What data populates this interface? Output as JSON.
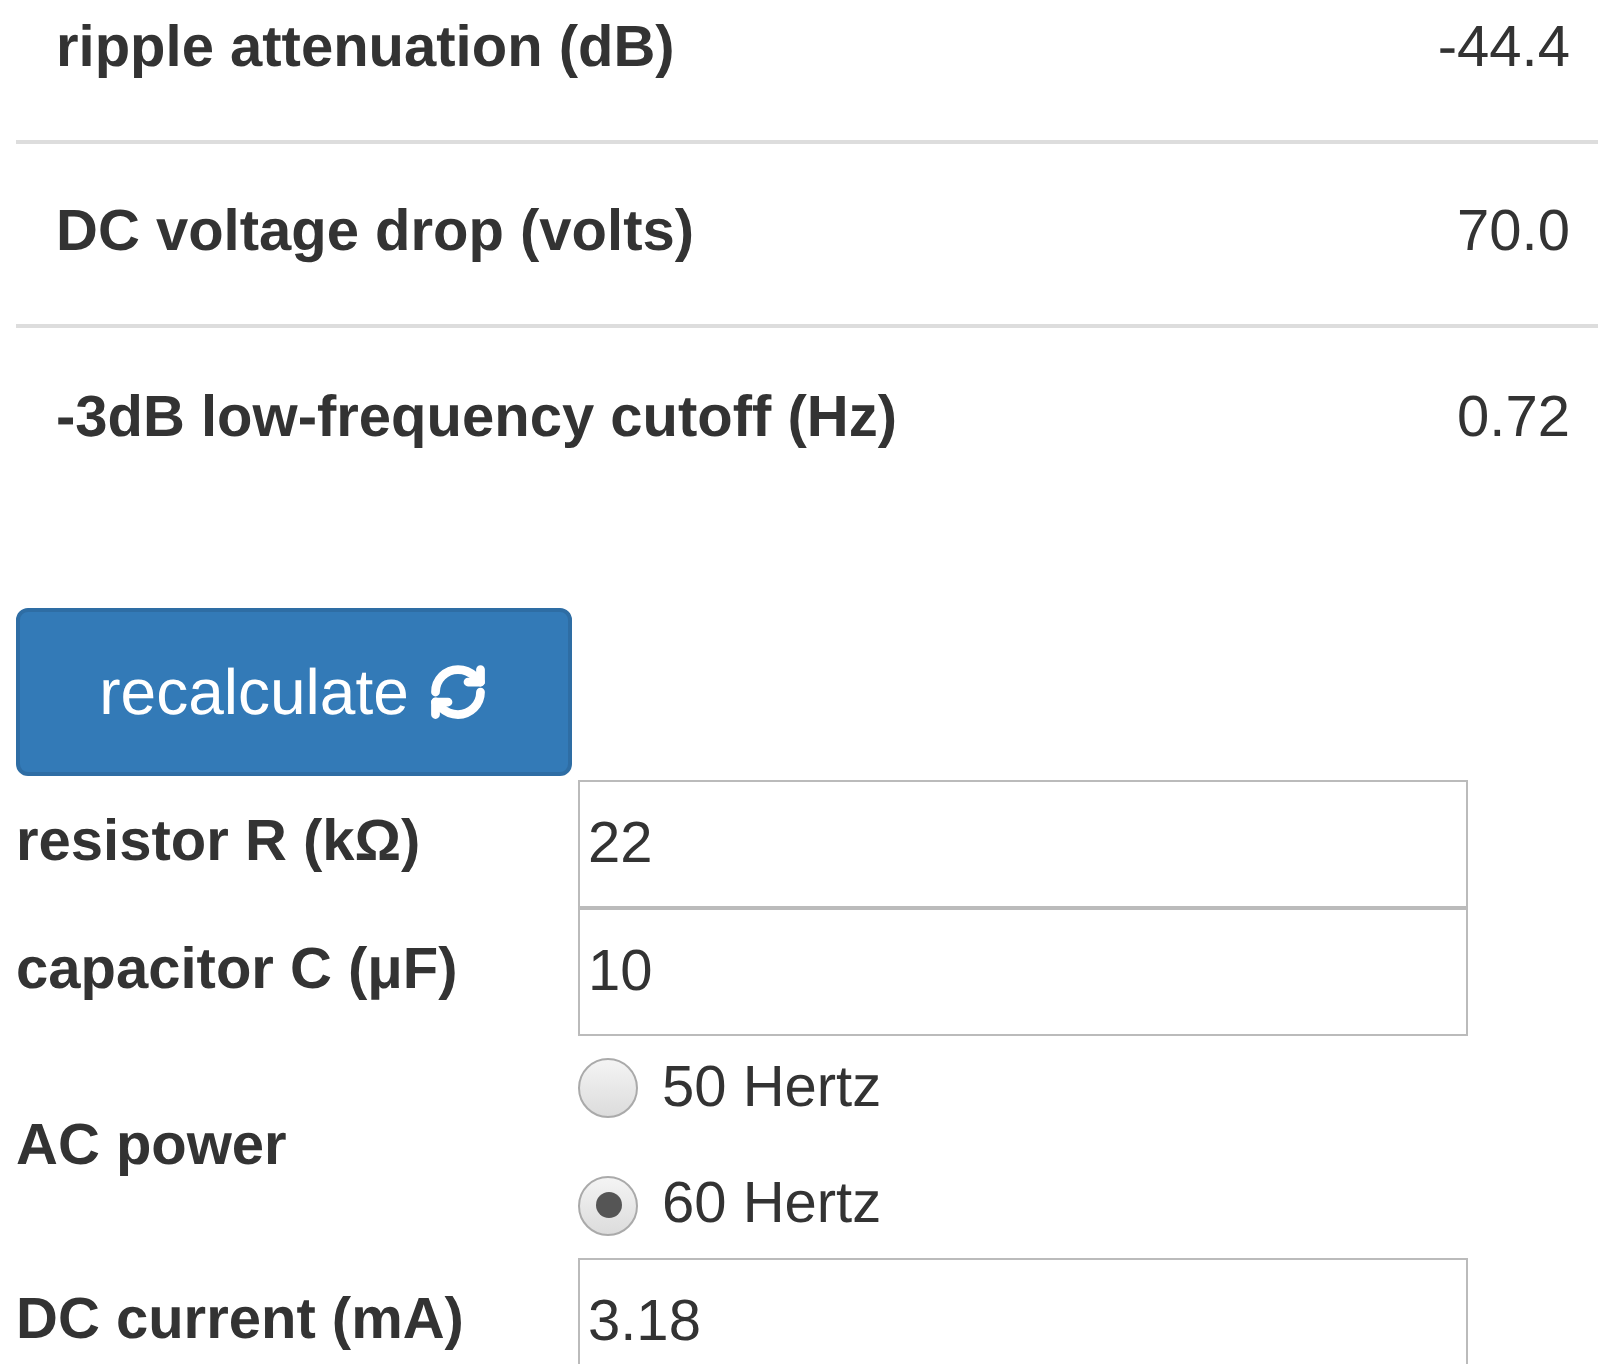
{
  "results": [
    {
      "label": "ripple attenuation (dB)",
      "value": "-44.4"
    },
    {
      "label": "DC voltage drop (volts)",
      "value": "70.0"
    },
    {
      "label": "-3dB low-frequency cutoff (Hz)",
      "value": "0.72"
    }
  ],
  "button": {
    "label": "recalculate"
  },
  "fields": [
    {
      "kind": "input",
      "label": "resistor R (kΩ)",
      "value": "22"
    },
    {
      "kind": "input",
      "label": "capacitor C (μF)",
      "value": "10"
    },
    {
      "kind": "radio",
      "label": "AC power",
      "options": [
        {
          "label": "50 Hertz",
          "selected": false
        },
        {
          "label": "60 Hertz",
          "selected": true
        }
      ]
    },
    {
      "kind": "input",
      "label": "DC current (mA)",
      "value": "3.18"
    }
  ]
}
